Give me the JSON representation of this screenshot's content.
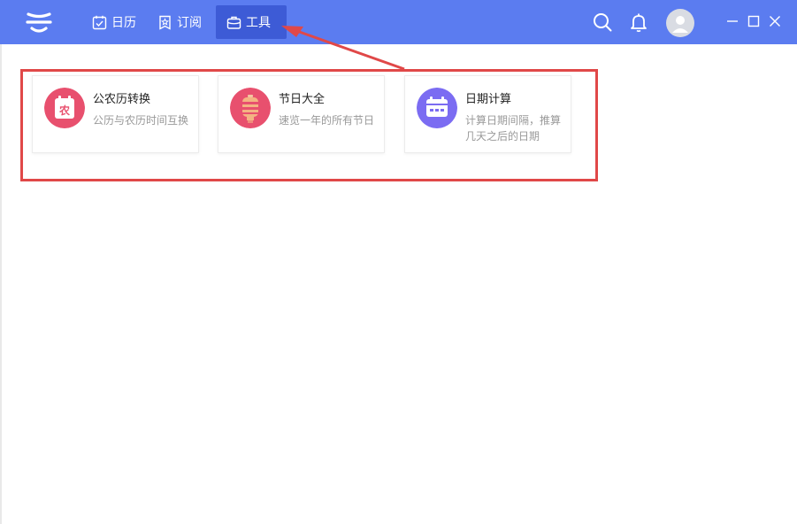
{
  "nav": {
    "calendar_label": "日历",
    "subscribe_label": "订阅",
    "tools_label": "工具"
  },
  "tools": [
    {
      "title": "公农历转换",
      "desc": "公历与农历时间互换",
      "icon": "lunar-calendar-icon",
      "icon_char": "农",
      "color": "#e8506e"
    },
    {
      "title": "节日大全",
      "desc": "速览一年的所有节日",
      "icon": "lantern-icon",
      "color": "#e8506e"
    },
    {
      "title": "日期计算",
      "desc": "计算日期间隔，推算几天之后的日期",
      "icon": "date-calc-icon",
      "color": "#7b6cf2"
    }
  ],
  "colors": {
    "topbar": "#5b7cf0",
    "active_tab": "#3d5bd6",
    "highlight": "#e04848"
  }
}
